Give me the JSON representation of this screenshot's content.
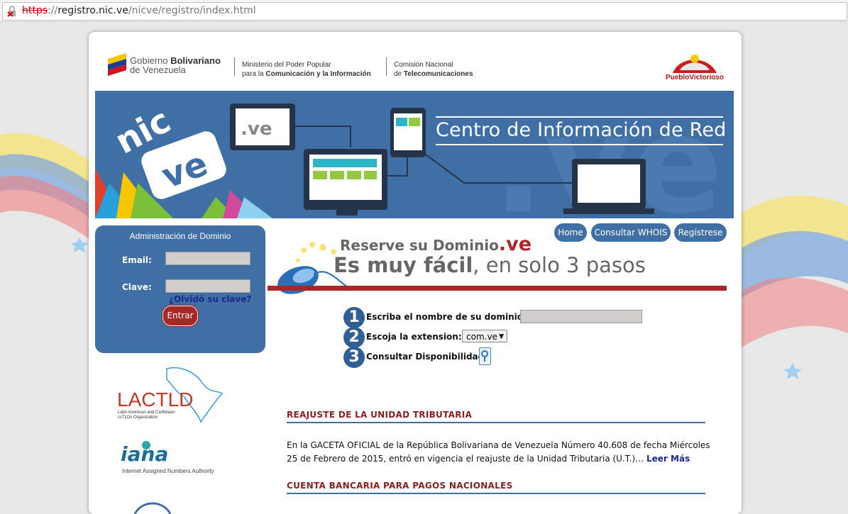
{
  "browser": {
    "url_scheme": "https",
    "url_sep": "://",
    "url_host": "registro.nic.ve",
    "url_path": "/nicve/registro/index.html"
  },
  "header": {
    "gov_line1_a": "Gobierno ",
    "gov_line1_b": "Bolivariano",
    "gov_line2": "de Venezuela",
    "ministry_line1": "Ministerio del Poder Popular",
    "ministry_line2_a": "para la ",
    "ministry_line2_b": "Comunicación y la Información",
    "conatel_line1": "Comisión Nacional",
    "conatel_line2_a": "de ",
    "conatel_line2_b": "Telecomunicaciones",
    "right_logo": "PuebloVictorioso"
  },
  "banner": {
    "title": "Centro de Información de Red",
    "logo_nic": "nic",
    "logo_ve": "ve",
    "screen_ve": ".ve"
  },
  "login": {
    "title": "Administración de Dominio",
    "email_label": "Email:",
    "password_label": "Clave:",
    "email_value": "",
    "password_value": "",
    "forgot": "¿Olvidó su clave?",
    "submit": "Entrar"
  },
  "nav": {
    "home": "Home",
    "whois": "Consultar WHOIS",
    "register": "Regístrese"
  },
  "reserve": {
    "line1": "Reserve su Dominio",
    "line1_ve": ".ve",
    "line2_a": "Es muy fácil",
    "line2_b": ", en solo 3 pasos"
  },
  "steps": [
    {
      "num": "1",
      "label": "Escriba el nombre de su dominio:"
    },
    {
      "num": "2",
      "label": "Escoja la extension:"
    },
    {
      "num": "3",
      "label": "Consultar Disponibilidad"
    }
  ],
  "domain_input_value": "",
  "extension_selected": "com.ve",
  "news": [
    {
      "heading": "REAJUSTE DE LA UNIDAD TRIBUTARIA",
      "body": "En la GACETA OFICIAL de la República Bolivariana de Venezuela Número 40.608 de fecha Miércoles 25 de Febrero de 2015, entró en vigencia el reajuste de la Unidad Tributaria (U.T.)…",
      "more": "Leer Más"
    },
    {
      "heading": "CUENTA BANCARIA PARA PAGOS NACIONALES"
    }
  ],
  "side_logos": {
    "lactld": "LACTLD",
    "lactld_sub1": "Latin American and Caribbean",
    "lactld_sub2": "ccTLDs Organization",
    "iana": "iana",
    "iana_sub": "Internet Assigned Numbers Authority"
  },
  "colors": {
    "primary_blue": "#3f6fa5",
    "accent_red": "#a82828",
    "link_blue": "#1b2a8a"
  }
}
